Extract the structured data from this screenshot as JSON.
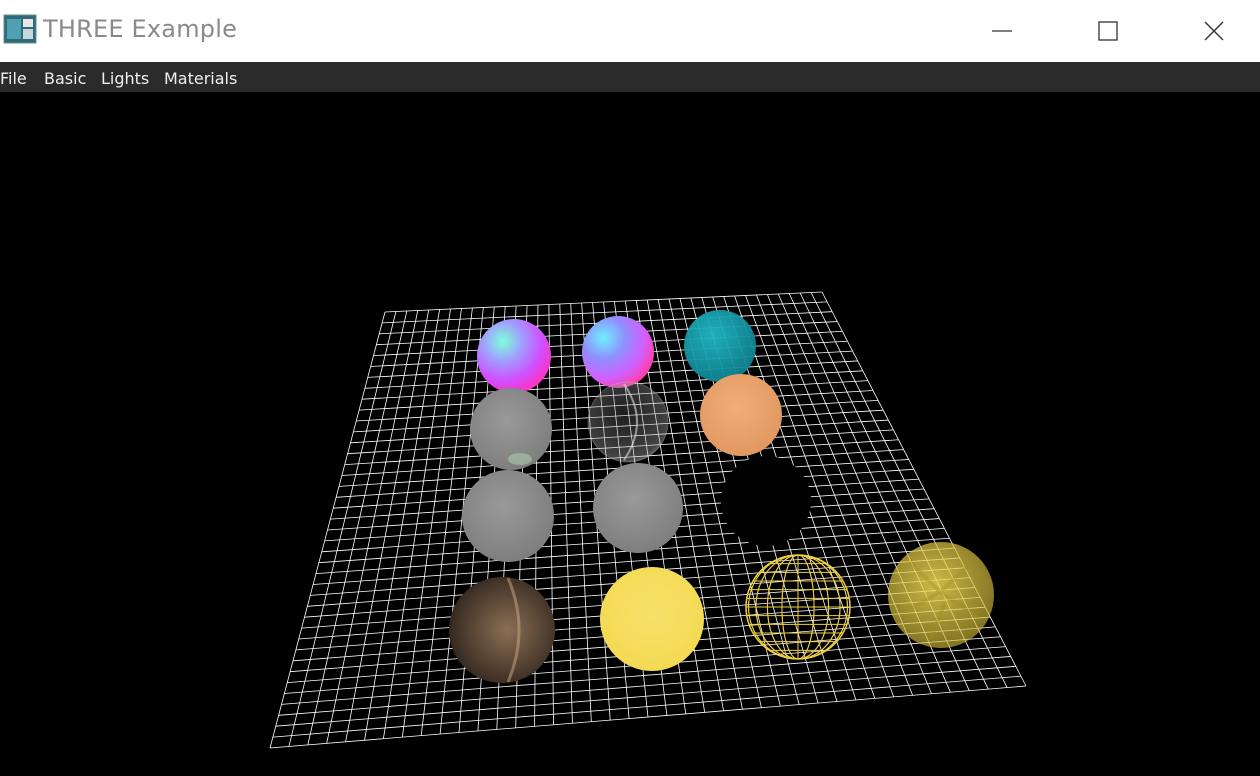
{
  "window": {
    "title": "THREE Example",
    "minimize_icon": "minimize-icon",
    "maximize_icon": "maximize-icon",
    "close_icon": "close-icon"
  },
  "menu": {
    "items": [
      {
        "label": "File"
      },
      {
        "label": "Basic"
      },
      {
        "label": "Lights"
      },
      {
        "label": "Materials"
      }
    ]
  },
  "viewport": {
    "background": "#000000",
    "grid_color": "#ffffff",
    "spheres": [
      {
        "name": "normal-material-sphere",
        "color": "#c070ff"
      },
      {
        "name": "normal-material-flat-sphere",
        "color": "#b070ff"
      },
      {
        "name": "teal-phong-sphere",
        "color": "#1fa0b0"
      },
      {
        "name": "gray-standard-sphere",
        "color": "#8c8c8c"
      },
      {
        "name": "transparent-glass-sphere",
        "color": "#9a9a9a"
      },
      {
        "name": "orange-lambert-sphere",
        "color": "#e8a066"
      },
      {
        "name": "gray-physical-sphere",
        "color": "#8a8a8a"
      },
      {
        "name": "gray-toon-sphere",
        "color": "#8a8a8a"
      },
      {
        "name": "black-depth-sphere",
        "color": "#050505"
      },
      {
        "name": "textured-wood-sphere",
        "color": "#5a4636"
      },
      {
        "name": "yellow-basic-sphere",
        "color": "#f5dc55"
      },
      {
        "name": "yellow-wireframe-sphere",
        "color": "#f0d040"
      },
      {
        "name": "yellow-translucent-sphere",
        "color": "#d8c040"
      }
    ]
  }
}
